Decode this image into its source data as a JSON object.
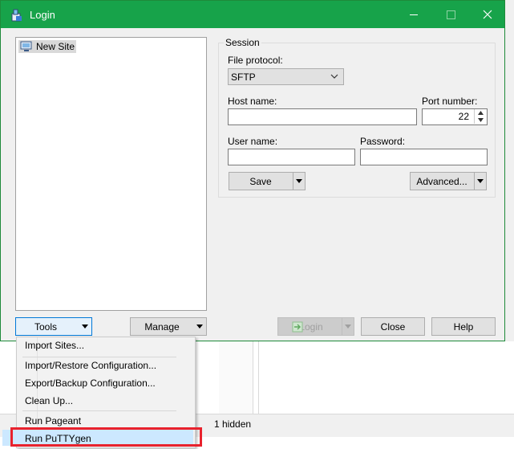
{
  "window": {
    "title": "Login",
    "title_icon": "winscp-icon"
  },
  "colors": {
    "titlebar": "#17a34a",
    "highlight": "#cce8ff",
    "annotation": "#e8222d"
  },
  "site_tree": {
    "items": [
      {
        "label": "New Site",
        "icon": "computer-site-icon"
      }
    ]
  },
  "session": {
    "legend": "Session",
    "file_protocol_label": "File protocol:",
    "file_protocol_value": "SFTP",
    "host_label": "Host name:",
    "host_value": "",
    "port_label": "Port number:",
    "port_value": "22",
    "user_label": "User name:",
    "user_value": "",
    "password_label": "Password:",
    "password_value": "",
    "save_label": "Save",
    "advanced_label": "Advanced..."
  },
  "buttons": {
    "tools": "Tools",
    "manage": "Manage",
    "login": "Login",
    "close": "Close",
    "help": "Help"
  },
  "tools_menu": {
    "items": [
      "Import Sites...",
      "Import/Restore Configuration...",
      "Export/Backup Configuration...",
      "Clean Up...",
      "Run Pageant",
      "Run PuTTYgen"
    ],
    "highlighted": "Run PuTTYgen"
  },
  "background": {
    "status_text": "1 hidden"
  }
}
